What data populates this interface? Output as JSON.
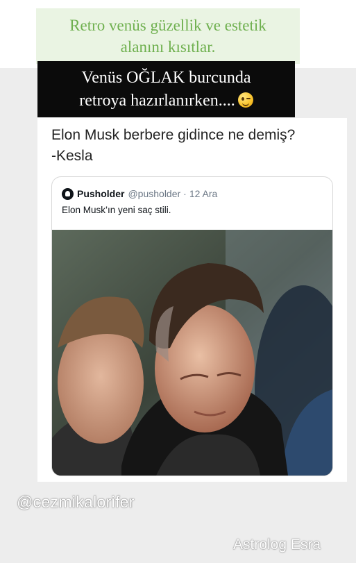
{
  "captions": {
    "green_line1": "Retro venüs güzellik ve estetik",
    "green_line2": "alanını kısıtlar.",
    "dark_line1": "Venüs OĞLAK burcunda",
    "dark_line2": "retroya hazırlanırken...."
  },
  "post": {
    "text_line1": "Elon Musk berbere gidince ne demiş?",
    "text_line2": "-Kesla"
  },
  "quote": {
    "name": "Pusholder",
    "handle": "@pusholder",
    "separator": "·",
    "date": "12 Ara",
    "text": "Elon Musk’ın yeni saç stili."
  },
  "watermarks": {
    "handle": "@cezmikalorifer",
    "name": "Astrolog Esra"
  },
  "icons": {
    "emoji": "winking-face-icon",
    "avatar": "pusholder-avatar-icon"
  }
}
